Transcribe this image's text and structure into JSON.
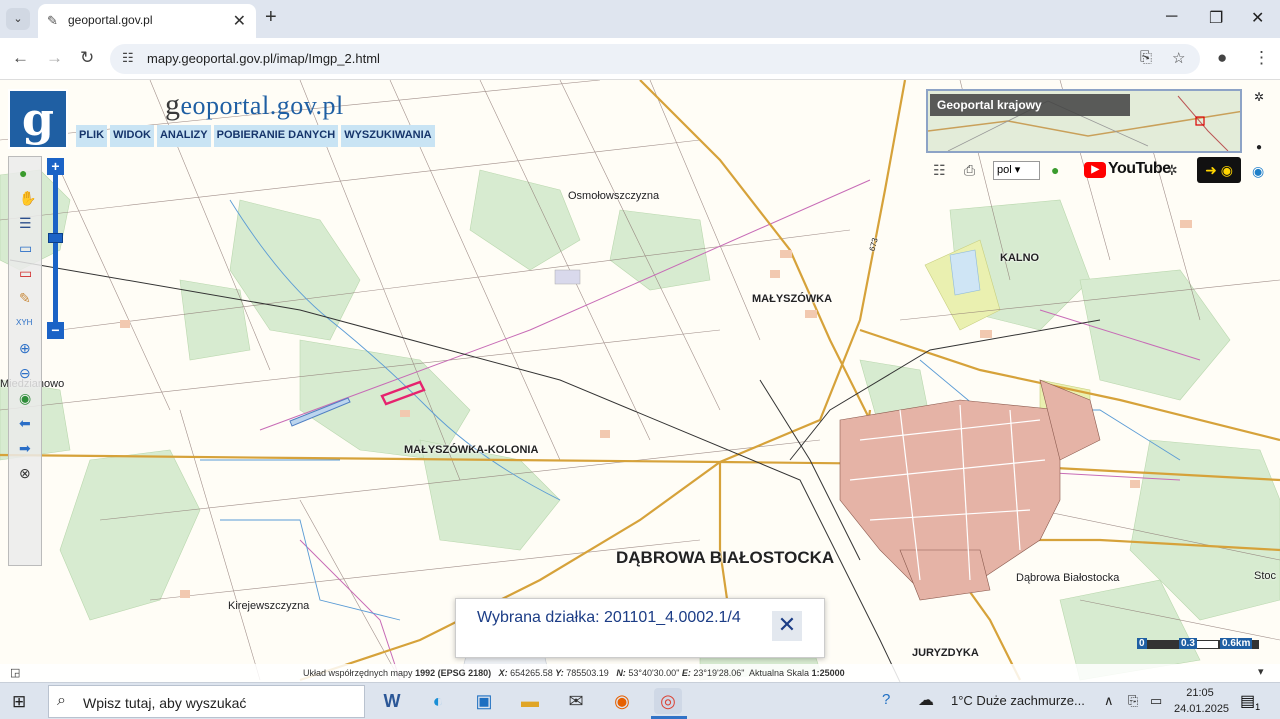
{
  "browser": {
    "tab_title": "geoportal.gov.pl",
    "tab_favicon": "globe-icon",
    "url": "mapy.geoportal.gov.pl/imap/Imgp_2.html"
  },
  "app": {
    "logo_letter": "g",
    "brand_g": "g",
    "brand_eo": "eoportal",
    "brand_rest": ".gov.pl",
    "menu": [
      "PLIK",
      "WIDOK",
      "ANALIZY",
      "POBIERANIE DANYCH",
      "WYSZUKIWANIA"
    ],
    "overview_label": "Geoportal krajowy",
    "language": "pol",
    "youtube_label": "YouTube"
  },
  "map": {
    "labels": {
      "osmolowszczyzna": "Osmołowszczyzna",
      "malyszowka": "MAŁYSZÓWKA",
      "kalno": "KALNO",
      "malyszowka_kolonia": "MAŁYSZÓWKA-KOLONIA",
      "dabrowa_city": "DĄBROWA BIAŁOSTOCKA",
      "dabrowa_station": "Dąbrowa Białostocka",
      "kirejewszczyzna": "Kirejewszczyzna",
      "juryzdyka": "JURYZDYKA",
      "miedzianowo": "Miedzianowo",
      "stoc": "Stoc",
      "road_673": "673"
    },
    "parcel_highlight_color": "#e6236e"
  },
  "popup": {
    "text": "Wybrana działka: 201101_4.0002.1/4",
    "close_icon": "close-icon"
  },
  "status": {
    "prefix": "Układ współrzędnych mapy",
    "crs": "1992 (EPSG 2180)",
    "x_label": "X:",
    "x_value": "654265.58",
    "y_label": "Y:",
    "y_value": "785503.19",
    "n_label": "N:",
    "n_value": "53°40'30.00\"",
    "e_label": "E:",
    "e_value": "23°19'28.06\"",
    "scale_label": "Aktualna Skala",
    "scale_value": "1:25000"
  },
  "scale_bar": {
    "zero": "0",
    "mid": "0.3",
    "end": "0.6km"
  },
  "taskbar": {
    "search_placeholder": "Wpisz tutaj, aby wyszukać",
    "weather": "1°C  Duże zachmurze...",
    "time": "21:05",
    "date": "24.01.2025",
    "notification_count": "1"
  }
}
